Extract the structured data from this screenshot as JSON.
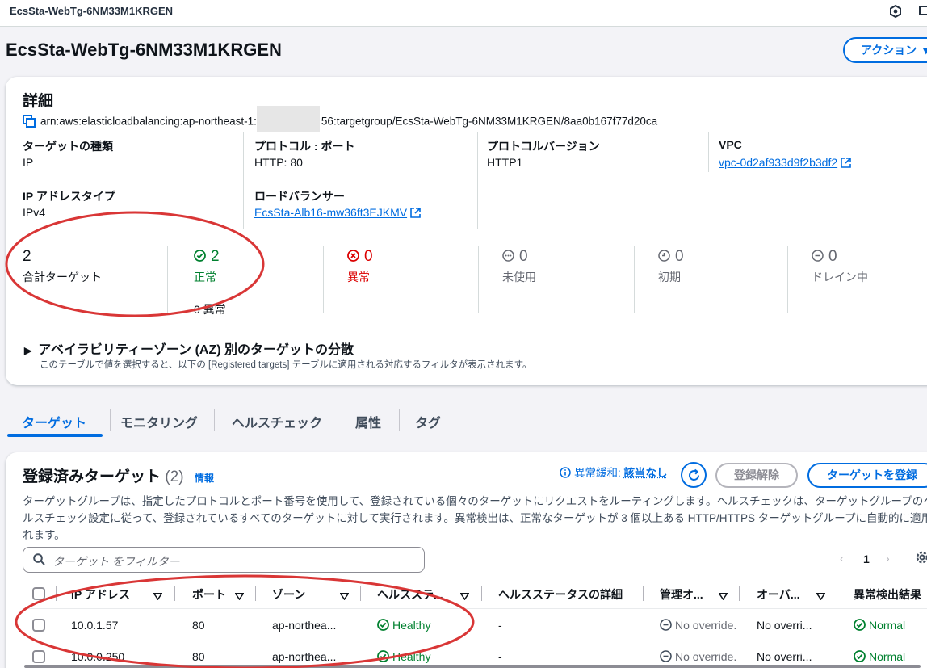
{
  "topbar": {
    "title": "EcsSta-WebTg-6NM33M1KRGEN"
  },
  "header": {
    "title": "EcsSta-WebTg-6NM33M1KRGEN",
    "actions_label": "アクション"
  },
  "details": {
    "heading": "詳細",
    "arn_prefix": "arn:aws:elasticloadbalancing:ap-northeast-1:",
    "arn_suffix": "56:targetgroup/EcsSta-WebTg-6NM33M1KRGEN/8aa0b167f77d20ca",
    "target_type_label": "ターゲットの種類",
    "target_type_value": "IP",
    "protocol_port_label": "プロトコル : ポート",
    "protocol_port_value": "HTTP: 80",
    "protocol_version_label": "プロトコルバージョン",
    "protocol_version_value": "HTTP1",
    "vpc_label": "VPC",
    "vpc_value": "vpc-0d2af933d9f2b3df2",
    "ip_type_label": "IP アドレスタイプ",
    "ip_type_value": "IPv4",
    "lb_label": "ロードバランサー",
    "lb_value": "EcsSta-Alb16-mw36ft3EJKMV"
  },
  "stats": {
    "total": {
      "value": "2",
      "label": "合計ターゲット"
    },
    "healthy": {
      "value": "2",
      "label": "正常",
      "sub": "0 異常"
    },
    "unhealthy": {
      "value": "0",
      "label": "異常"
    },
    "unused": {
      "value": "0",
      "label": "未使用"
    },
    "initial": {
      "value": "0",
      "label": "初期"
    },
    "draining": {
      "value": "0",
      "label": "ドレイン中"
    }
  },
  "az": {
    "title": "アベイラビリティーゾーン (AZ) 別のターゲットの分散",
    "description": "このテーブルで値を選択すると、以下の [Registered targets] テーブルに適用される対応するフィルタが表示されます。"
  },
  "tabs": [
    "ターゲット",
    "モニタリング",
    "ヘルスチェック",
    "属性",
    "タグ"
  ],
  "targets": {
    "title": "登録済みターゲット",
    "count": "(2)",
    "info": "情報",
    "anomaly_prefix": "異常緩和: ",
    "anomaly_value": "該当なし",
    "deregister_label": "登録解除",
    "register_label": "ターゲットを登録",
    "description": "ターゲットグループは、指定したプロトコルとポート番号を使用して、登録されている個々のターゲットにリクエストをルーティングします。ヘルスチェックは、ターゲットグループのヘルスチェック設定に従って、登録されているすべてのターゲットに対して実行されます。異常検出は、正常なターゲットが 3 個以上ある HTTP/HTTPS ターゲットグループに自動的に適用されます。",
    "search_placeholder": "ターゲット をフィルター",
    "page": "1",
    "columns": [
      "IP アドレス",
      "ポート",
      "ゾーン",
      "ヘルスステ...",
      "ヘルスステータスの詳細",
      "管理オ...",
      "オーバ...",
      "異常検出結果"
    ],
    "rows": [
      {
        "ip": "10.0.1.57",
        "port": "80",
        "zone": "ap-northea...",
        "health": "Healthy",
        "detail": "-",
        "override": "No override.",
        "override2": "No overri...",
        "anomaly": "Normal"
      },
      {
        "ip": "10.0.0.250",
        "port": "80",
        "zone": "ap-northea...",
        "health": "Healthy",
        "detail": "-",
        "override": "No override.",
        "override2": "No overri...",
        "anomaly": "Normal"
      }
    ]
  },
  "colors": {
    "accent": "#006ce0",
    "success": "#00802f",
    "error": "#db0000",
    "annotation": "#d93636"
  }
}
